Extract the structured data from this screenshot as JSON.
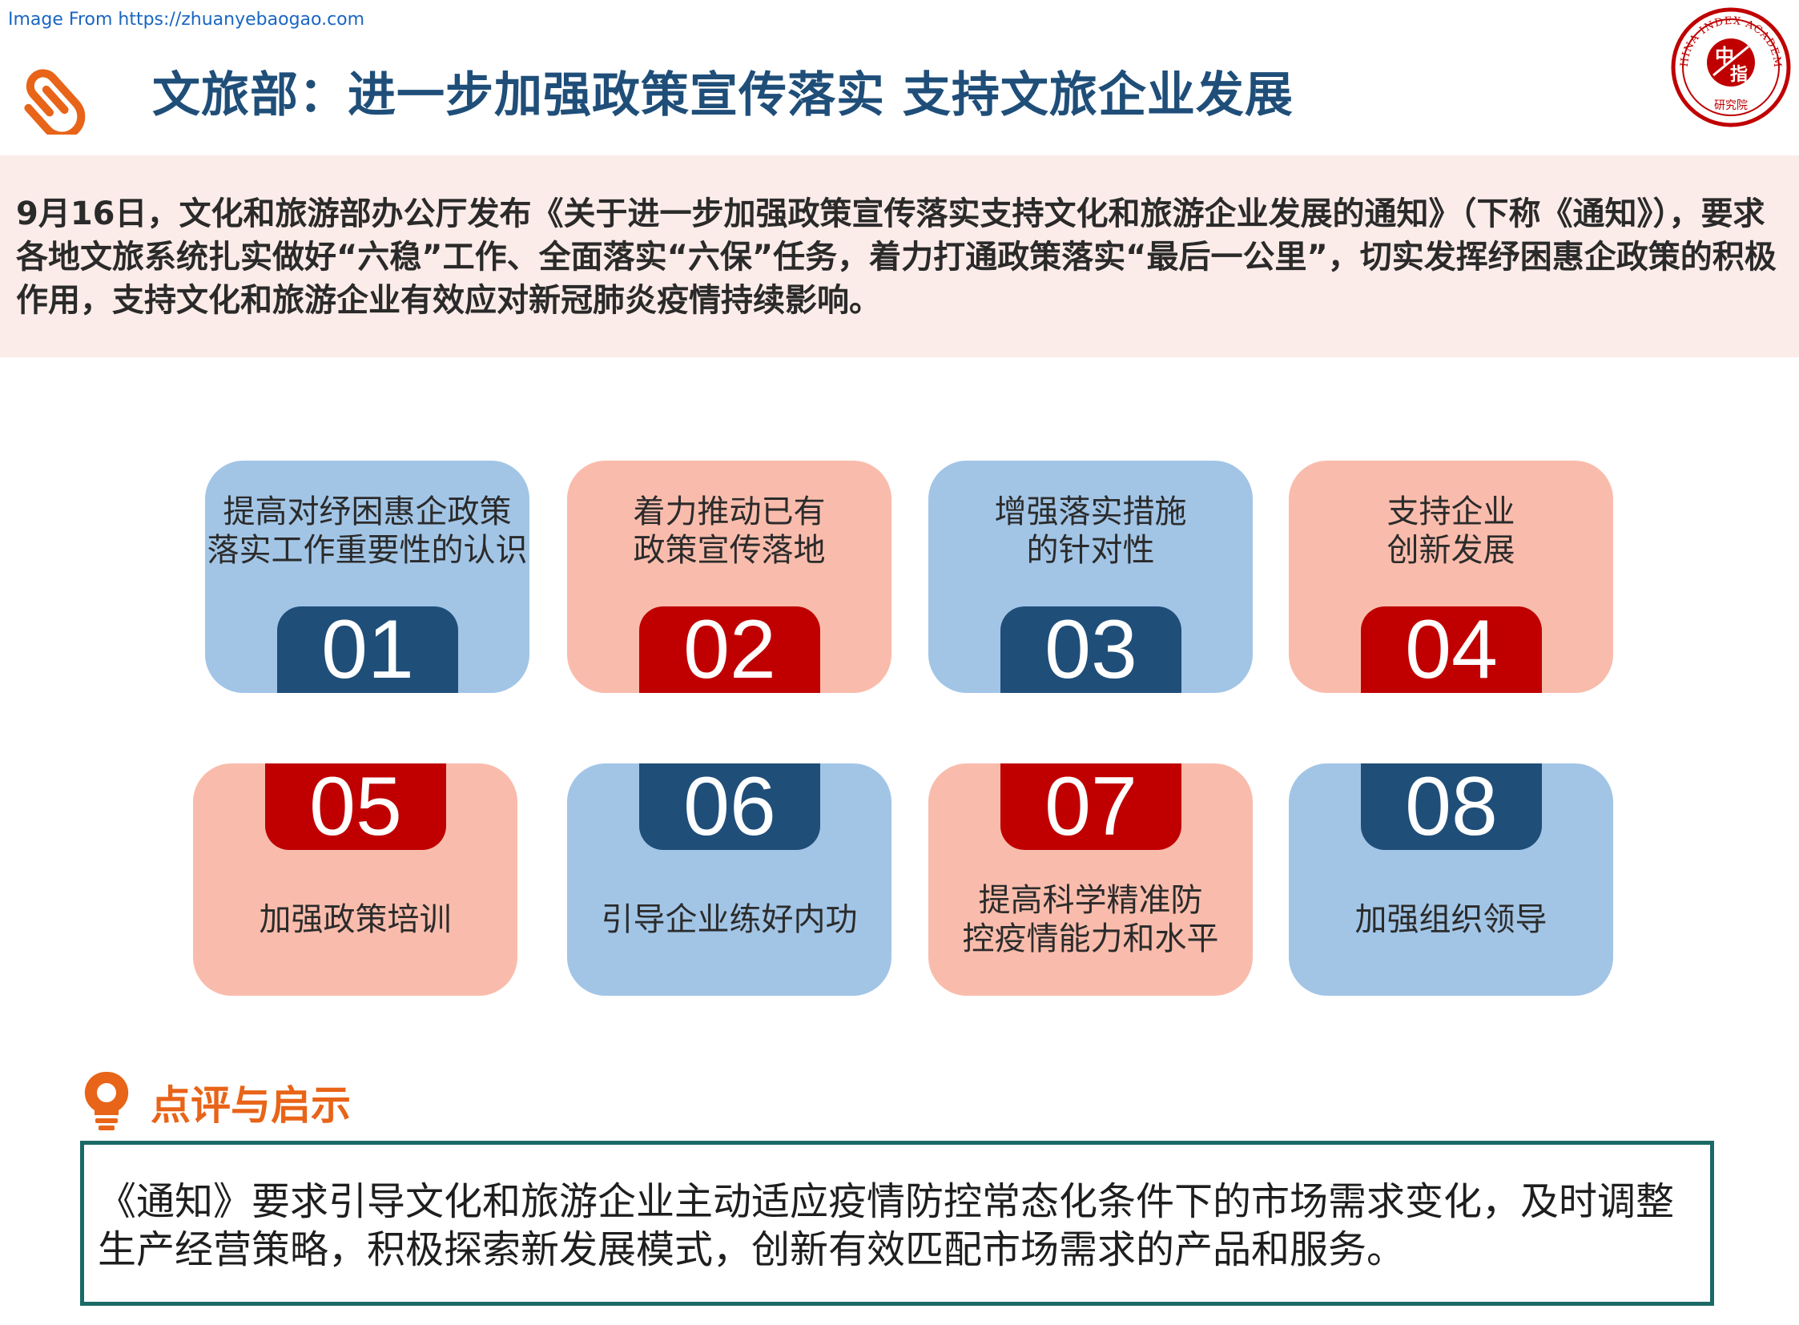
{
  "source_text": "Image From https://zhuanyebaogao.com",
  "header": {
    "title": "文旅部：进一步加强政策宣传落实 支持文旅企业发展",
    "seal": {
      "outer_text": "CHINA INDEX ACADEMY",
      "char1": "中",
      "char2": "指",
      "bottom_text": "研究院",
      "color": "#c00000"
    }
  },
  "intro": {
    "text": "9月16日，文化和旅游部办公厅发布《关于进一步加强政策宣传落实支持文化和旅游企业发展的通知》（下称《通知》），要求各地文旅系统扎实做好“六稳”工作、全面落实“六保”任务，着力打通政策落实“最后一公里”，切实发挥纾困惠企政策的积极作用，支持文化和旅游企业有效应对新冠肺炎疫情持续影响。"
  },
  "cards": [
    {
      "number": "01",
      "text": "提高对纾困惠企政策\n落实工作重要性的认识",
      "theme": "blue"
    },
    {
      "number": "02",
      "text": "着力推动已有\n政策宣传落地",
      "theme": "pink"
    },
    {
      "number": "03",
      "text": "增强落实措施\n的针对性",
      "theme": "blue"
    },
    {
      "number": "04",
      "text": "支持企业\n创新发展",
      "theme": "pink"
    },
    {
      "number": "05",
      "text": "加强政策培训",
      "theme": "pink"
    },
    {
      "number": "06",
      "text": "引导企业练好内功",
      "theme": "blue"
    },
    {
      "number": "07",
      "text": "提高科学精准防\n控疫情能力和水平",
      "theme": "pink"
    },
    {
      "number": "08",
      "text": "加强组织领导",
      "theme": "blue"
    }
  ],
  "comment": {
    "heading": "点评与启示",
    "text": "《通知》要求引导文化和旅游企业主动适应疫情防控常态化条件下的市场需求变化，及时调整生产经营策略，积极探索新发展模式，创新有效匹配市场需求的产品和服务。"
  },
  "colors": {
    "title": "#1f4e79",
    "accent_orange": "#e86418",
    "navy": "#1f4e79",
    "red": "#c00000",
    "blue_card": "#a2c5e6",
    "pink_card": "#f9bcac",
    "intro_band": "#fcece9",
    "box_border": "#1a6a66"
  },
  "icons": {
    "header": "paperclip-icon",
    "comment": "lightbulb-icon",
    "logo": "seal-logo"
  }
}
